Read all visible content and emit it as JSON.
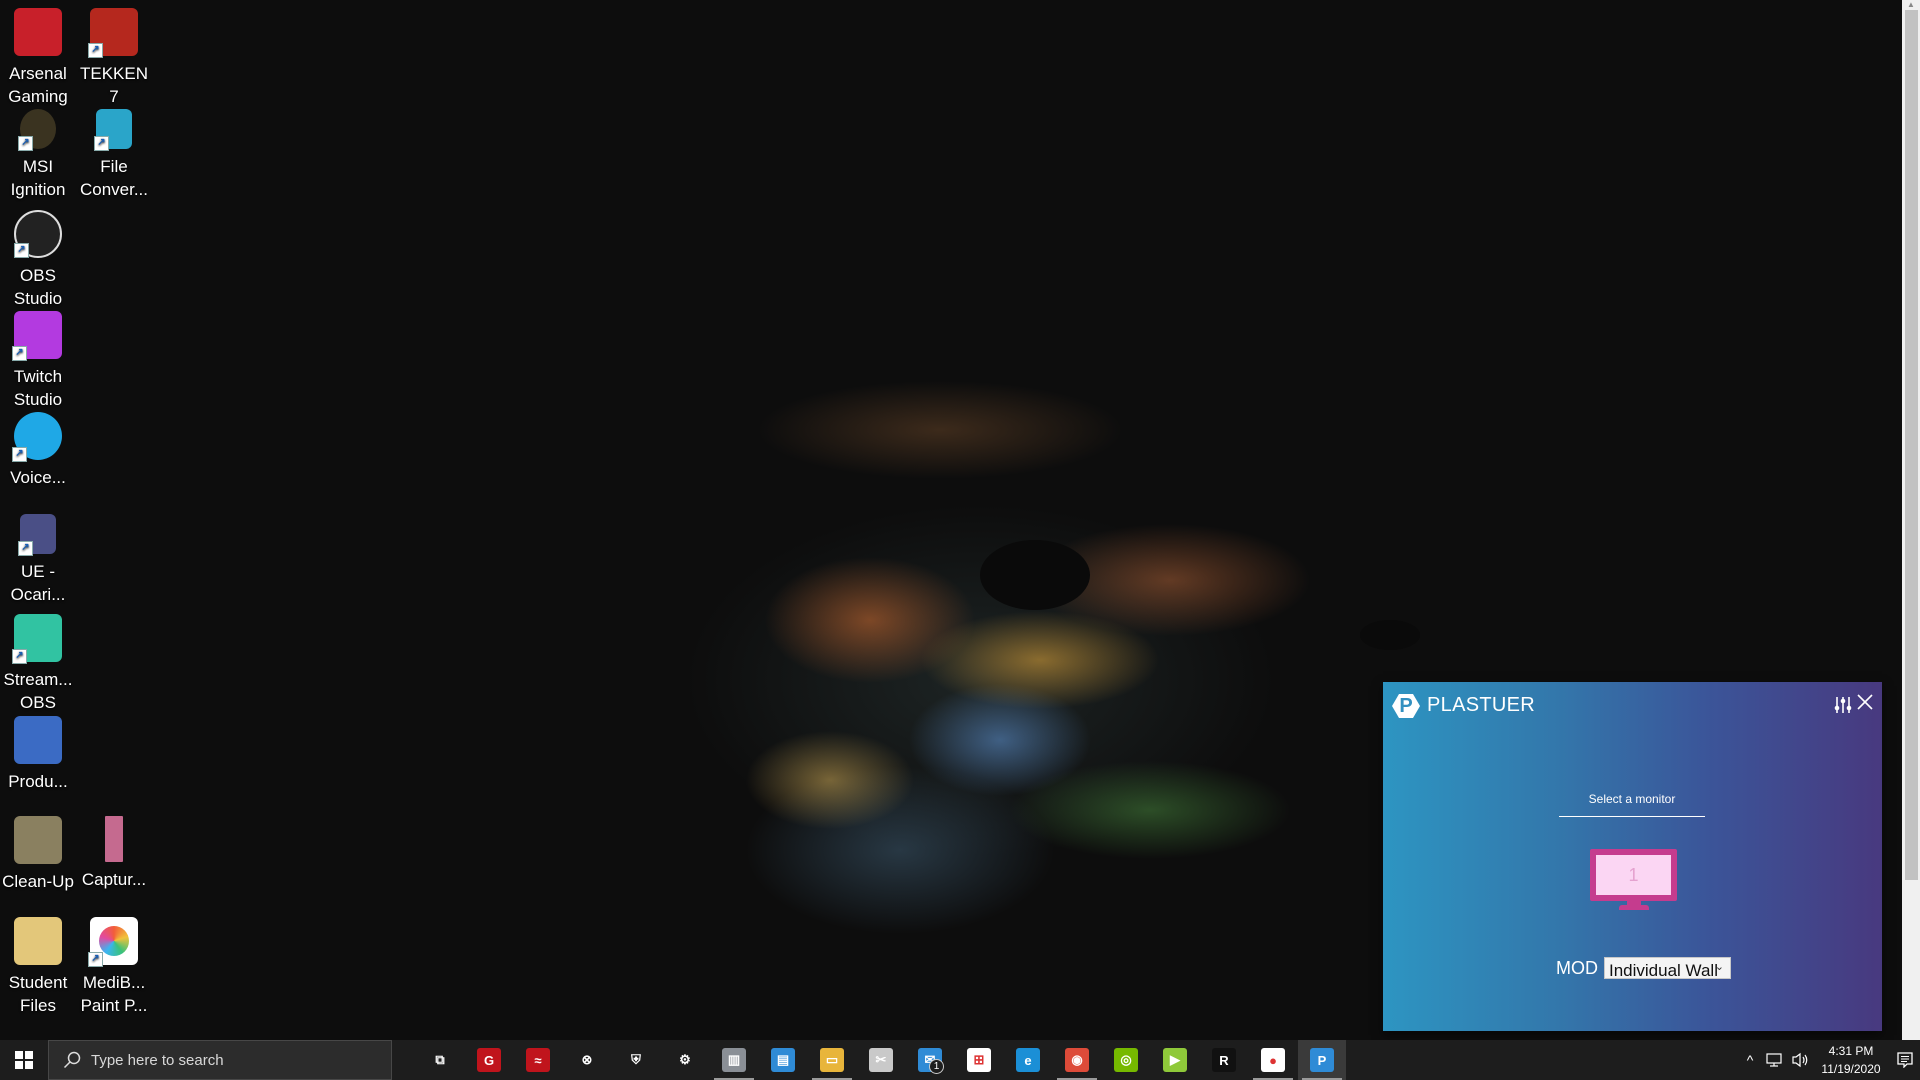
{
  "desktop": {
    "icons": [
      {
        "label": "Arsenal Gaming",
        "line1": "Arsenal",
        "line2": "Gaming",
        "icon": "msi-dragon-shield-icon",
        "color": "#c8202a",
        "shortcut": false
      },
      {
        "label": "TEKKEN 7",
        "line1": "TEKKEN",
        "line2": "7",
        "icon": "tekken-icon",
        "color": "#b5281e",
        "shortcut": true
      },
      {
        "label": "MSI Ignition",
        "line1": "MSI",
        "line2": "Ignition",
        "icon": "msi-badge-icon",
        "color": "#3a3320",
        "shortcut": true
      },
      {
        "label": "File Converter",
        "line1": "File",
        "line2": "Conver...",
        "icon": "file-converter-icon",
        "color": "#2aa5c9",
        "shortcut": true
      },
      {
        "label": "OBS Studio",
        "line1": "OBS",
        "line2": "Studio",
        "icon": "obs-icon",
        "color": "#222222",
        "shortcut": true
      },
      {
        "label": "Twitch Studio",
        "line1": "Twitch",
        "line2": "Studio",
        "icon": "twitch-icon",
        "color": "#b33ae0",
        "shortcut": true
      },
      {
        "label": "Voice...",
        "line1": "Voice...",
        "line2": "",
        "icon": "voicemod-icon",
        "color": "#1fa8e6",
        "shortcut": true
      },
      {
        "label": "UE - Ocari...",
        "line1": "UE -",
        "line2": "Ocari...",
        "icon": "hylian-shield-icon",
        "color": "#4a4f86",
        "shortcut": true
      },
      {
        "label": "Stream... OBS",
        "line1": "Stream...",
        "line2": "OBS",
        "icon": "streamlabs-icon",
        "color": "#31c3a2",
        "shortcut": true
      },
      {
        "label": "Produ...",
        "line1": "Produ...",
        "line2": "",
        "icon": "film-strip-icon",
        "color": "#3b6bc4",
        "shortcut": false
      },
      {
        "label": "Clean-Up",
        "line1": "Clean-Up",
        "line2": "",
        "icon": "folder-icon",
        "color": "#8a8060",
        "shortcut": false
      },
      {
        "label": "Captur...",
        "line1": "Captur...",
        "line2": "",
        "icon": "image-file-icon",
        "color": "#c56a8f",
        "shortcut": false
      },
      {
        "label": "Student Files",
        "line1": "Student",
        "line2": "Files",
        "icon": "pdf-folder-icon",
        "color": "#e3c77a",
        "shortcut": false
      },
      {
        "label": "MediBang Paint Pro",
        "line1": "MediB...",
        "line2": "Paint P...",
        "icon": "medibang-icon",
        "color": "#ffffff",
        "shortcut": true
      }
    ]
  },
  "plastuer": {
    "title": "PLASTUER",
    "logo_letter": "P",
    "select_monitor_label": "Select a monitor",
    "monitor_number": "1",
    "mode_label": "MOD",
    "mode_value": "Individual Wall",
    "settings_icon": "sliders-icon",
    "close_icon": "✕",
    "colors": {
      "gradient_start": "#2d95c2",
      "gradient_end": "#48397f",
      "monitor_frame": "#c53c8e",
      "monitor_screen": "#fbd6f3"
    }
  },
  "taskbar": {
    "search_placeholder": "Type here to search",
    "apps": [
      {
        "name": "task-view",
        "glyph": "⧉",
        "color": "transparent",
        "running": false
      },
      {
        "name": "msi-dragon-center",
        "glyph": "G",
        "color": "#c0141c",
        "running": false
      },
      {
        "name": "tekken-launcher",
        "glyph": "≈",
        "color": "#c0141c",
        "running": false
      },
      {
        "name": "xbox",
        "glyph": "⊗",
        "color": "transparent",
        "running": false
      },
      {
        "name": "windows-security",
        "glyph": "⛨",
        "color": "transparent",
        "running": false
      },
      {
        "name": "settings",
        "glyph": "⚙",
        "color": "transparent",
        "running": false
      },
      {
        "name": "system-monitor",
        "glyph": "▥",
        "color": "#8a8f96",
        "running": true
      },
      {
        "name": "control-panel",
        "glyph": "▤",
        "color": "#2f8bd6",
        "running": false
      },
      {
        "name": "file-explorer",
        "glyph": "▭",
        "color": "#e8b53b",
        "running": true
      },
      {
        "name": "snipping-tool",
        "glyph": "✂",
        "color": "#c9c9c9",
        "running": false
      },
      {
        "name": "mail",
        "glyph": "✉",
        "color": "#2f8bd6",
        "running": false,
        "badge": "1"
      },
      {
        "name": "microsoft-store",
        "glyph": "⊞",
        "color": "#ffffff",
        "running": false
      },
      {
        "name": "edge",
        "glyph": "e",
        "color": "#1b8fd6",
        "running": false
      },
      {
        "name": "chrome",
        "glyph": "◉",
        "color": "#dd4b39",
        "running": true
      },
      {
        "name": "nvidia",
        "glyph": "◎",
        "color": "#76b900",
        "running": false
      },
      {
        "name": "fl-studio",
        "glyph": "▶",
        "color": "#8fc93a",
        "running": false
      },
      {
        "name": "ryzen-master",
        "glyph": "R",
        "color": "#111111",
        "running": false
      },
      {
        "name": "medibang",
        "glyph": "●",
        "color": "#ffffff",
        "running": true
      },
      {
        "name": "plastuer",
        "glyph": "P",
        "color": "#2f8bd6",
        "running": true,
        "active": true
      }
    ],
    "tray": {
      "chevron": "^",
      "time": "4:31 PM",
      "date": "11/19/2020",
      "notification_badge": ""
    }
  }
}
